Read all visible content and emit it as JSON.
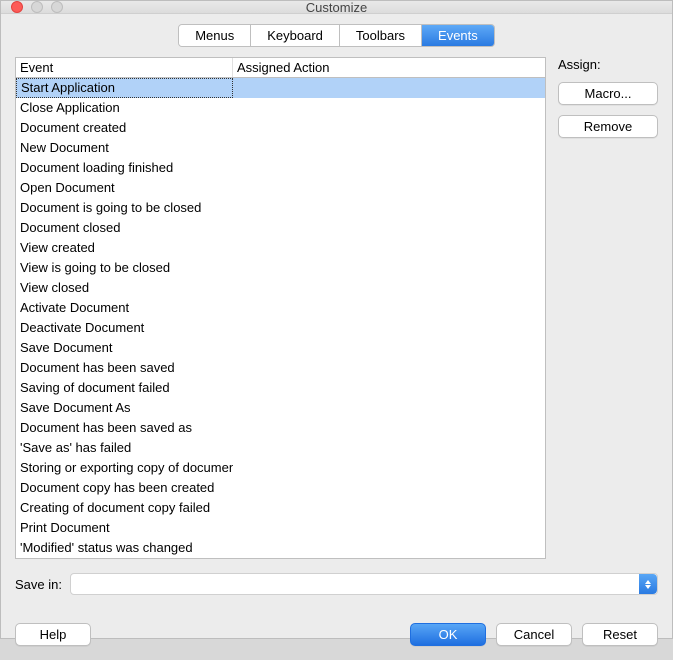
{
  "window": {
    "title": "Customize"
  },
  "tabs": {
    "items": [
      {
        "label": "Menus",
        "active": false
      },
      {
        "label": "Keyboard",
        "active": false
      },
      {
        "label": "Toolbars",
        "active": false
      },
      {
        "label": "Events",
        "active": true
      }
    ]
  },
  "table": {
    "headers": {
      "event": "Event",
      "action": "Assigned Action"
    },
    "selected_index": 0,
    "rows": [
      {
        "event": "Start Application",
        "action": ""
      },
      {
        "event": "Close Application",
        "action": ""
      },
      {
        "event": "Document created",
        "action": ""
      },
      {
        "event": "New Document",
        "action": ""
      },
      {
        "event": "Document loading finished",
        "action": ""
      },
      {
        "event": "Open Document",
        "action": ""
      },
      {
        "event": "Document is going to be closed",
        "action": ""
      },
      {
        "event": "Document closed",
        "action": ""
      },
      {
        "event": "View created",
        "action": ""
      },
      {
        "event": "View is going to be closed",
        "action": ""
      },
      {
        "event": "View closed",
        "action": ""
      },
      {
        "event": "Activate Document",
        "action": ""
      },
      {
        "event": "Deactivate Document",
        "action": ""
      },
      {
        "event": "Save Document",
        "action": ""
      },
      {
        "event": "Document has been saved",
        "action": ""
      },
      {
        "event": "Saving of document failed",
        "action": ""
      },
      {
        "event": "Save Document As",
        "action": ""
      },
      {
        "event": "Document has been saved as",
        "action": ""
      },
      {
        "event": "'Save as' has failed",
        "action": ""
      },
      {
        "event": "Storing or exporting copy of document",
        "action": ""
      },
      {
        "event": "Document copy has been created",
        "action": ""
      },
      {
        "event": "Creating of document copy failed",
        "action": ""
      },
      {
        "event": "Print Document",
        "action": ""
      },
      {
        "event": "'Modified' status was changed",
        "action": ""
      }
    ]
  },
  "side": {
    "assign_label": "Assign:",
    "macro_label": "Macro...",
    "remove_label": "Remove"
  },
  "savein": {
    "label": "Save in:",
    "value": ""
  },
  "footer": {
    "help": "Help",
    "ok": "OK",
    "cancel": "Cancel",
    "reset": "Reset"
  }
}
